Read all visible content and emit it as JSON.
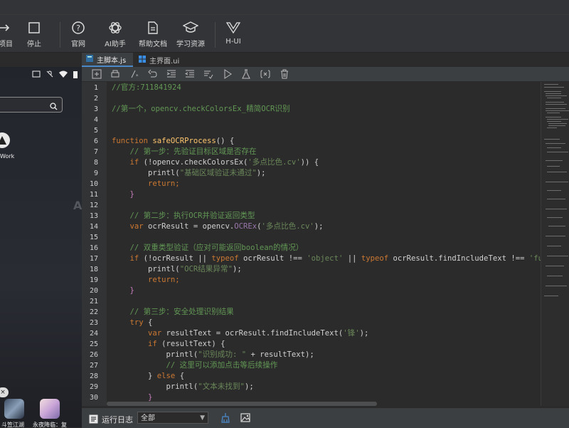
{
  "toolbar": {
    "buttons": [
      {
        "label": "项目",
        "icon": "arrow-right-icon"
      },
      {
        "label": "停止",
        "icon": "stop-icon"
      },
      {
        "label": "官网",
        "icon": "help-icon"
      },
      {
        "label": "AI助手",
        "icon": "openai-icon"
      },
      {
        "label": "帮助文档",
        "icon": "document-icon"
      },
      {
        "label": "学习资源",
        "icon": "graduation-cap-icon"
      },
      {
        "label": "H-UI",
        "icon": "vue-icon"
      }
    ]
  },
  "phone": {
    "work_label": "Work",
    "close_label": "×",
    "watermark": "A",
    "apps": [
      {
        "label": "斗笠江湖"
      },
      {
        "label": "永夜降临：复"
      }
    ]
  },
  "tabs": [
    {
      "label": "主脚本.js",
      "active": true
    },
    {
      "label": "主界面.ui",
      "active": false
    }
  ],
  "editor": {
    "line_numbers": [
      "1",
      "2",
      "3",
      "4",
      "5",
      "6",
      "7",
      "8",
      "9",
      "10",
      "11",
      "12",
      "13",
      "14",
      "15",
      "16",
      "17",
      "18",
      "19",
      "20",
      "21",
      "22",
      "23",
      "24",
      "25",
      "26",
      "27",
      "28",
      "29",
      "30"
    ],
    "lines": {
      "l1": "//官方:711841924",
      "l3": "//第一个，opencv.checkColorsEx_精简OCR识别",
      "l6_kw": "function",
      "l6_fn": "safeOCRProcess",
      "l6_rest": "() {",
      "l7": "// 第一步：先验证目标区域是否存在",
      "l8_kw": "if",
      "l8_a": " (!opencv.checkColorsEx(",
      "l8_str": "'多点比色.cv'",
      "l8_b": ")) {",
      "l9_a": "printl(",
      "l9_str": "\"基础区域验证未通过\"",
      "l9_b": ");",
      "l10": "return;",
      "l11": "}",
      "l13": "// 第二步：执行OCR并验证返回类型",
      "l14_kw": "var",
      "l14_a": " ocrResult = opencv.",
      "l14_prop": "OCREx",
      "l14_b": "(",
      "l14_str": "'多点比色.cv'",
      "l14_c": ");",
      "l16": "// 双重类型验证（应对可能返回boolean的情况）",
      "l17_kw": "if",
      "l17_a": " (!ocrResult || ",
      "l17_kw2": "typeof",
      "l17_b": " ocrResult !== ",
      "l17_str": "'object'",
      "l17_c": " || ",
      "l17_kw3": "typeof",
      "l17_d": " ocrResult.findIncludeText !== ",
      "l17_str2": "'func",
      "l18_a": "printl(",
      "l18_str": "\"OCR结果异常\"",
      "l18_b": ");",
      "l19": "return;",
      "l20": "}",
      "l22": "// 第三步：安全处理识别结果",
      "l23_kw": "try",
      "l23_rest": " {",
      "l24_kw": "var",
      "l24_a": " resultText = ocrResult.findIncludeText(",
      "l24_str": "'锋'",
      "l24_b": ");",
      "l25_kw": "if",
      "l25_a": " (resultText) {",
      "l26_a": "printl(",
      "l26_str": "\"识别成功: \"",
      "l26_b": " + resultText);",
      "l27": "// 这里可以添加点击等后续操作",
      "l28_a": "} ",
      "l28_kw": "else",
      "l28_b": " {",
      "l29_a": "printl(",
      "l29_str": "\"文本未找到\"",
      "l29_b": ");",
      "l30": "}"
    }
  },
  "bottom": {
    "log_label": "运行日志",
    "filter_value": "全部",
    "filter_arrow": "▼"
  },
  "colors": {
    "keyword": "#cc7832",
    "function": "#ffc66d",
    "string": "#6a8759",
    "comment": "#629755",
    "accent": "#4a88c7"
  }
}
